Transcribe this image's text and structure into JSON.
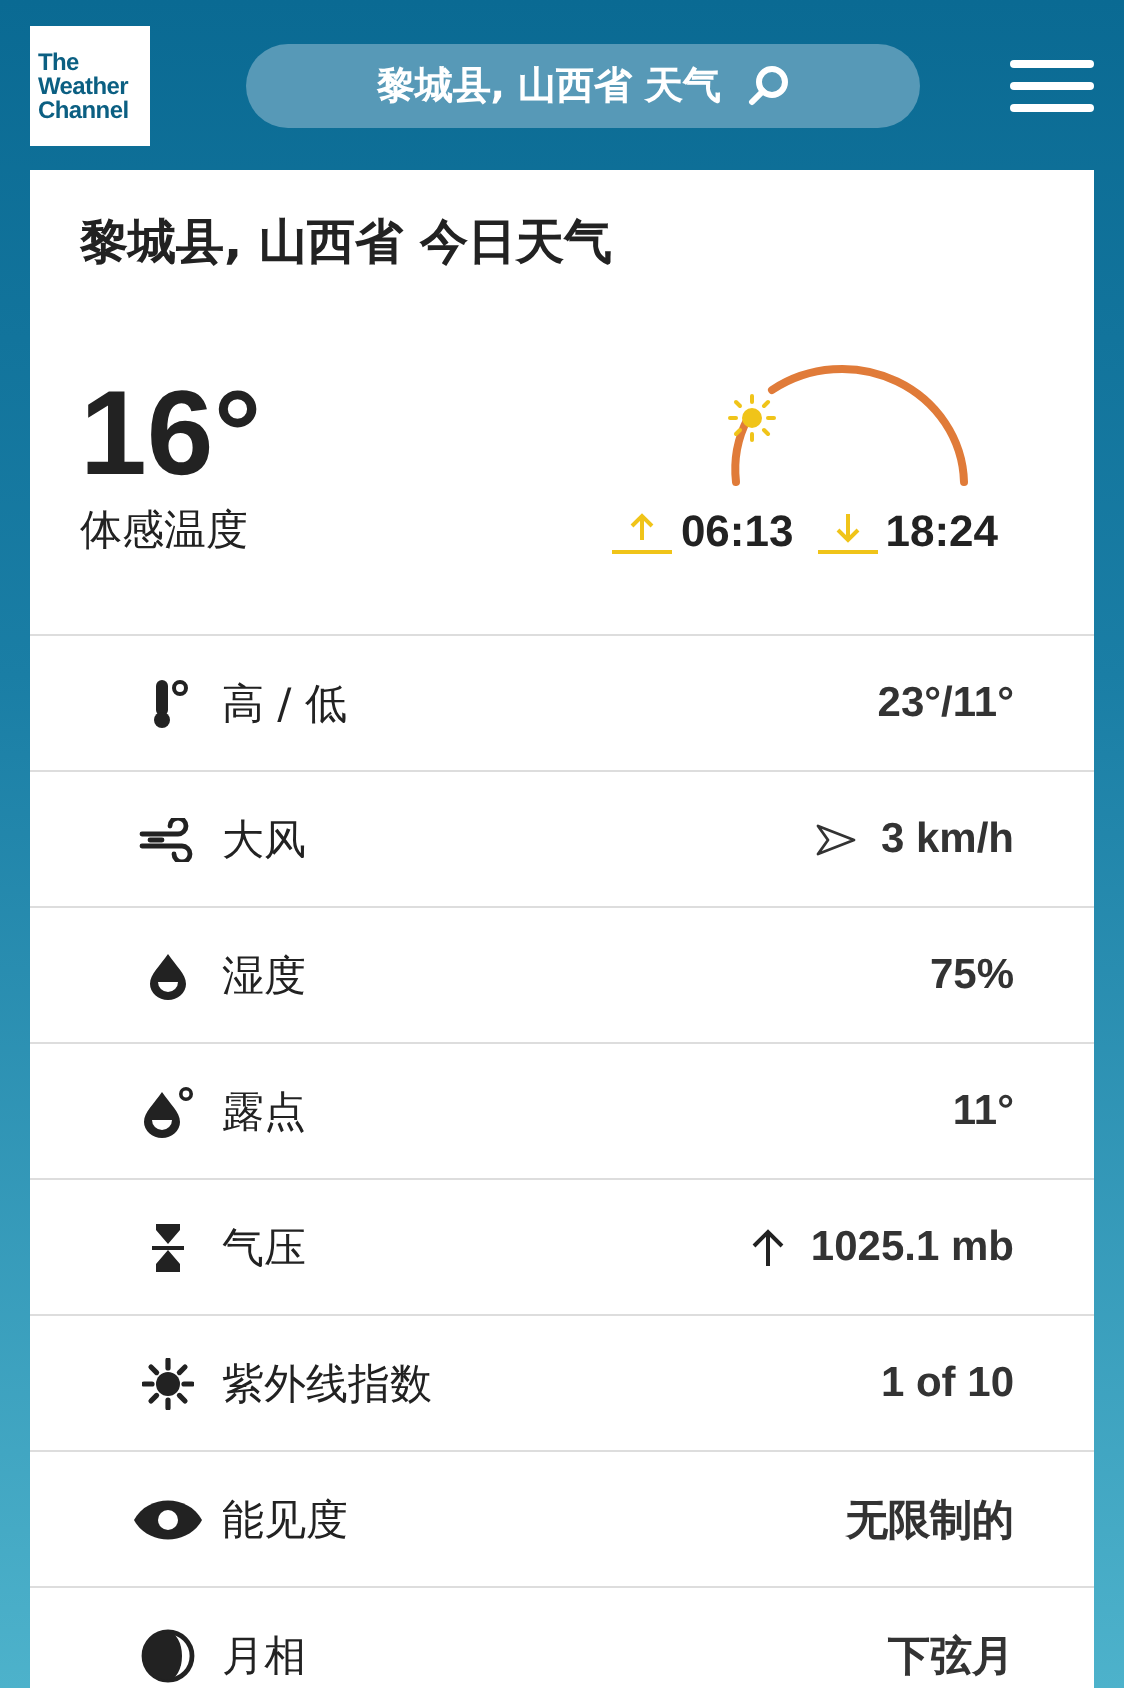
{
  "header": {
    "logo": {
      "lines": [
        "The",
        "Weather",
        "Channel"
      ]
    },
    "search": {
      "value": "黎城县, 山西省 天气"
    }
  },
  "today": {
    "title": "黎城县, 山西省 今日天气",
    "temperature": "16°",
    "feels_like_label": "体感温度",
    "sunrise": "06:13",
    "sunset": "18:24"
  },
  "details": [
    {
      "kind": "thermometer",
      "label": "高 / 低",
      "value": "23°/11°"
    },
    {
      "kind": "wind",
      "label": "大风",
      "value": "3 km/h",
      "direction_arrow": true
    },
    {
      "kind": "humidity",
      "label": "湿度",
      "value": "75%"
    },
    {
      "kind": "dew",
      "label": "露点",
      "value": "11°"
    },
    {
      "kind": "pressure",
      "label": "气压",
      "value": "1025.1 mb",
      "rising": true
    },
    {
      "kind": "uv",
      "label": "紫外线指数",
      "value": "1 of 10"
    },
    {
      "kind": "visibility",
      "label": "能见度",
      "value": "无限制的"
    },
    {
      "kind": "moon",
      "label": "月相",
      "value": "下弦月"
    }
  ]
}
